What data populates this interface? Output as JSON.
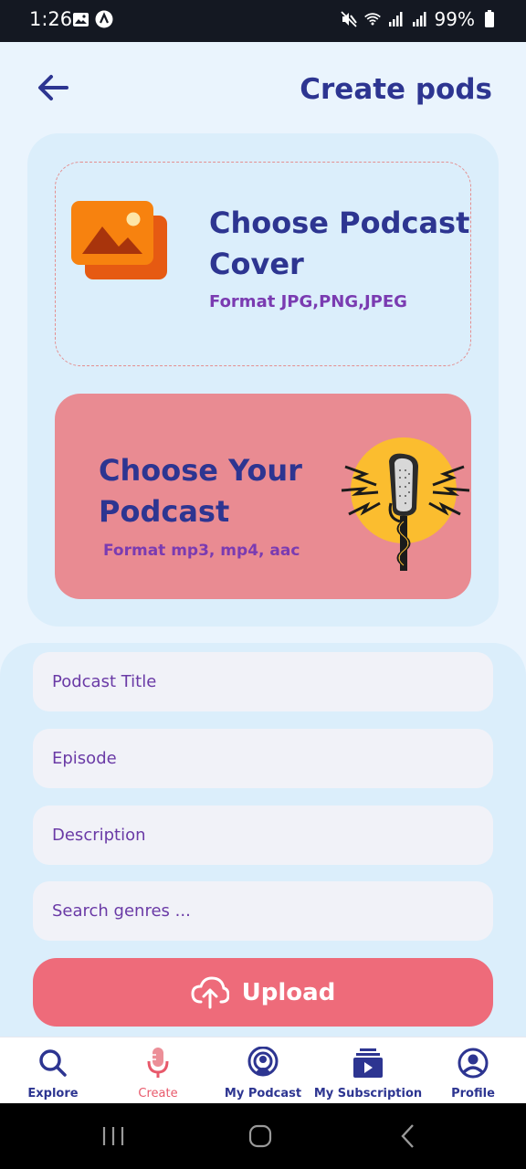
{
  "status_bar": {
    "time": "1:26",
    "battery": "99%",
    "left_icons": [
      "image-icon",
      "app-a-icon"
    ],
    "right_icons": [
      "mute-icon",
      "wifi-icon",
      "signal-icon",
      "signal-icon",
      "battery-icon"
    ]
  },
  "header": {
    "title": "Create pods",
    "back_icon": "arrow-left-icon"
  },
  "cover_picker": {
    "title": "Choose Podcast Cover",
    "format": "Format JPG,PNG,JPEG",
    "icon": "image-gallery-icon"
  },
  "podcast_picker": {
    "title": "Choose Your Podcast",
    "format": "Format mp3, mp4, aac",
    "illustration": "vintage-microphone-illustration"
  },
  "form": {
    "title_placeholder": "Podcast Title",
    "episode_placeholder": "Episode",
    "description_placeholder": "Description",
    "genres_placeholder": "Search genres ..."
  },
  "upload": {
    "label": "Upload",
    "icon": "cloud-upload-icon"
  },
  "bottom_nav": {
    "items": [
      {
        "label": "Explore",
        "icon": "search-icon",
        "active": false
      },
      {
        "label": "Create",
        "icon": "microphone-icon",
        "active": true
      },
      {
        "label": "My Podcast",
        "icon": "podcast-icon",
        "active": false
      },
      {
        "label": "My Subscription",
        "icon": "subscription-icon",
        "active": false
      },
      {
        "label": "Profile",
        "icon": "profile-icon",
        "active": false
      }
    ]
  },
  "colors": {
    "primary": "#2d3591",
    "accent": "#ee6b7a",
    "accent_light": "#e98b92",
    "text_purple": "#7a3bb1",
    "panel": "#dbeefb",
    "background": "#eaf4fd"
  }
}
